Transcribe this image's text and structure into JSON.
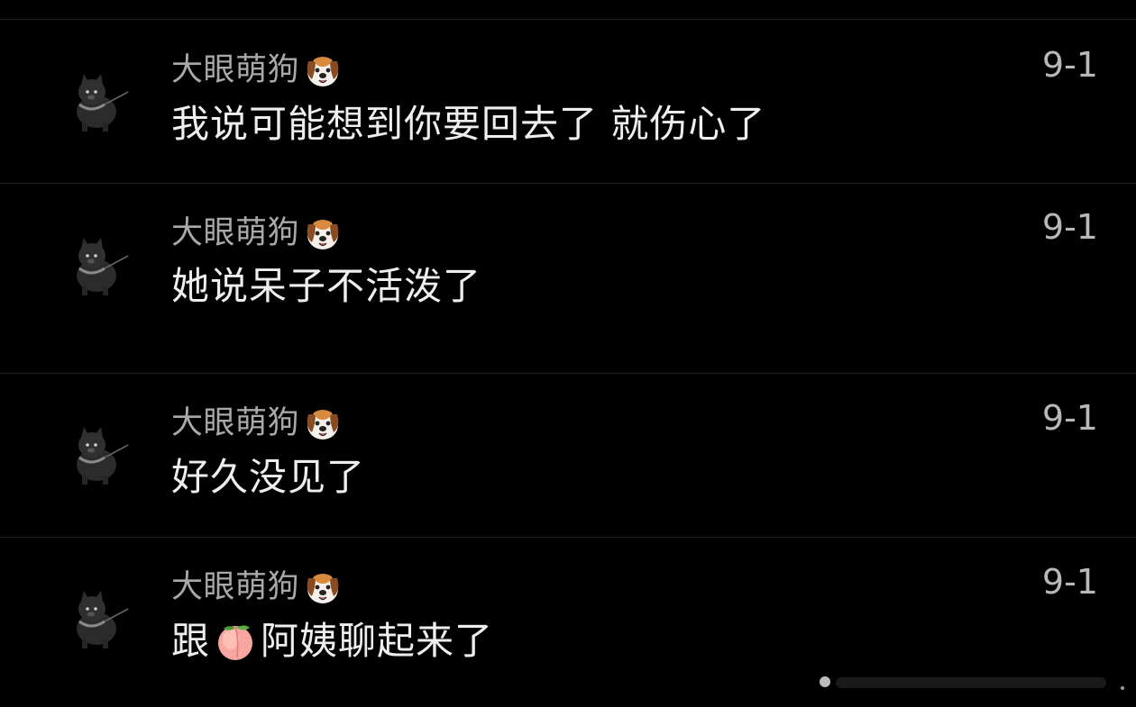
{
  "messages": [
    {
      "user": "大眼萌狗",
      "text": "我说可能想到你要回去了 就伤心了",
      "date": "9-1"
    },
    {
      "user": "大眼萌狗",
      "text": "她说呆子不活泼了",
      "date": "9-1"
    },
    {
      "user": "大眼萌狗",
      "text": "好久没见了",
      "date": "9-1"
    },
    {
      "user": "大眼萌狗",
      "text_before": "跟",
      "text_after": "阿姨聊起来了",
      "date": "9-1"
    }
  ],
  "icons": {
    "avatar": "black-dog-avatar",
    "name_badge": "dog-face-emoji",
    "inline_emoji": "peach-emoji"
  },
  "colors": {
    "background": "#000000",
    "username": "#a9a9a9",
    "message": "#eeeeee",
    "date": "#b8b8b8",
    "divider": "#1f1f1f"
  }
}
